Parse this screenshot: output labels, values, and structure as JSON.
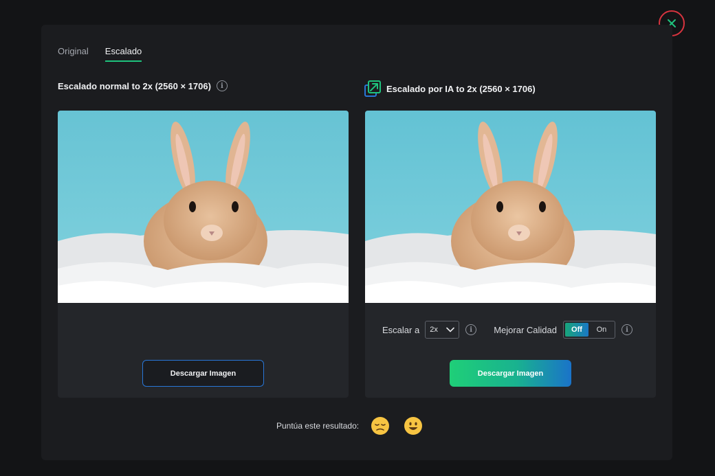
{
  "tabs": [
    {
      "label": "Original",
      "active": false
    },
    {
      "label": "Escalado",
      "active": true
    }
  ],
  "left": {
    "heading": "Escalado normal to 2x (2560 × 1706)",
    "button": "Descargar Imagen"
  },
  "right": {
    "heading": "Escalado por IA to 2x (2560 × 1706)",
    "scale_label": "Escalar a",
    "scale_value": "2x",
    "quality_label": "Mejorar Calidad",
    "toggle": {
      "off": "Off",
      "on": "On",
      "selected": "Off"
    },
    "button": "Descargar Imagen"
  },
  "rating": {
    "label": "Puntúa este resultado:",
    "options": [
      "sad-face-icon",
      "happy-face-icon"
    ]
  },
  "icons": {
    "close": "close-icon",
    "info": "info-icon",
    "ai_upscale": "upscale-arrow-icon",
    "chevron": "chevron-down-icon"
  },
  "colors": {
    "accent_green": "#1fc37e",
    "accent_blue": "#2877d8",
    "close_red": "#d8343f"
  }
}
